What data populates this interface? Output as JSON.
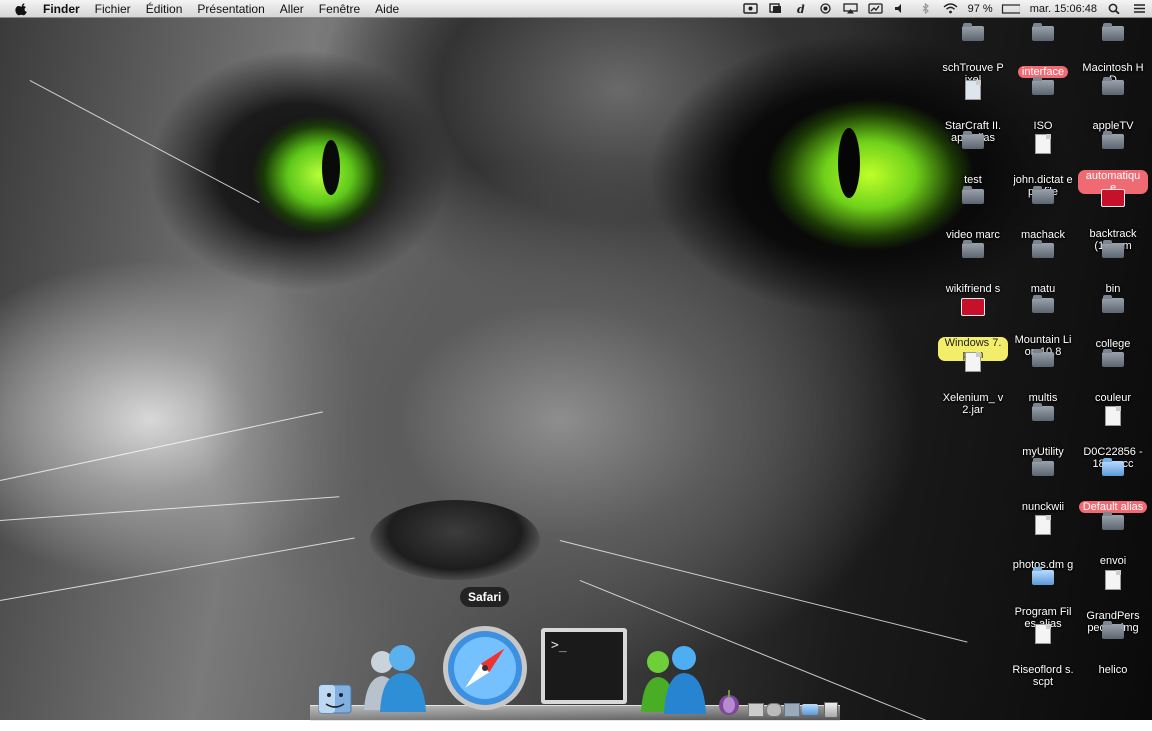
{
  "menubar": {
    "apple_icon": "apple-icon",
    "app_name": "Finder",
    "items": [
      "Fichier",
      "Édition",
      "Présentation",
      "Aller",
      "Fenêtre",
      "Aide"
    ],
    "battery": "97 %",
    "clock": "mar. 15:06:48",
    "tray_icons": [
      "screen-recorder-icon",
      "growl-icon",
      "dictionary-icon",
      "record-icon",
      "airplay-icon",
      "cast-icon",
      "volume-icon",
      "bluetooth-icon",
      "wifi-icon",
      "battery-icon",
      "search-icon",
      "list-icon"
    ]
  },
  "desktop": {
    "icons": [
      {
        "label": "schTrouve Pixel",
        "kind": "folder",
        "tag": ""
      },
      {
        "label": "interface",
        "kind": "folder",
        "tag": "red"
      },
      {
        "label": "Macintosh HD",
        "kind": "folder",
        "tag": ""
      },
      {
        "label": "StarCraft II.app alias",
        "kind": "app",
        "tag": ""
      },
      {
        "label": "ISO",
        "kind": "folder",
        "tag": ""
      },
      {
        "label": "appleTV",
        "kind": "folder",
        "tag": ""
      },
      {
        "label": "test",
        "kind": "folder",
        "tag": ""
      },
      {
        "label": "john.dictat eprofile",
        "kind": "doc",
        "tag": ""
      },
      {
        "label": "automatiqu e",
        "kind": "folder",
        "tag": "red"
      },
      {
        "label": "video marc",
        "kind": "folder",
        "tag": ""
      },
      {
        "label": "machack",
        "kind": "folder",
        "tag": ""
      },
      {
        "label": "backtrack (1).pvm",
        "kind": "pvm",
        "tag": ""
      },
      {
        "label": "wikifriend s",
        "kind": "folder",
        "tag": ""
      },
      {
        "label": "matu",
        "kind": "folder",
        "tag": ""
      },
      {
        "label": "bin",
        "kind": "folder",
        "tag": ""
      },
      {
        "label": "Windows 7.pvm",
        "kind": "pvm",
        "tag": "yellow"
      },
      {
        "label": "Mountain Lion 10.8",
        "kind": "folder",
        "tag": ""
      },
      {
        "label": "college",
        "kind": "folder",
        "tag": ""
      },
      {
        "label": "Xelenium_ v2.jar",
        "kind": "doc",
        "tag": ""
      },
      {
        "label": "multis",
        "kind": "folder",
        "tag": ""
      },
      {
        "label": "couleur",
        "kind": "folder",
        "tag": ""
      },
      {
        "label": "myUtility",
        "kind": "folder",
        "tag": ""
      },
      {
        "label": "D0C22856 -18....scc",
        "kind": "doc",
        "tag": ""
      },
      {
        "label": "nunckwii",
        "kind": "folder",
        "tag": ""
      },
      {
        "label": "Default alias",
        "kind": "folder-blue",
        "tag": "red"
      },
      {
        "label": "photos.dm g",
        "kind": "doc",
        "tag": ""
      },
      {
        "label": "envoi",
        "kind": "folder",
        "tag": ""
      },
      {
        "label": "Program Files alias",
        "kind": "folder-blue",
        "tag": ""
      },
      {
        "label": "GrandPers pect...dmg",
        "kind": "doc",
        "tag": ""
      },
      {
        "label": "Riseoflord s.scpt",
        "kind": "doc",
        "tag": ""
      },
      {
        "label": "helico",
        "kind": "folder",
        "tag": ""
      }
    ]
  },
  "dock": {
    "tooltip": "Safari",
    "terminal_prompt": ">_",
    "items": [
      "finder-icon",
      "messenger-icon",
      "safari-icon",
      "terminal-icon",
      "chat-icon",
      "tor-browser-icon",
      "mini-app-icon",
      "mini-app-icon",
      "mini-app-icon",
      "folder-icon",
      "trash-icon"
    ]
  }
}
